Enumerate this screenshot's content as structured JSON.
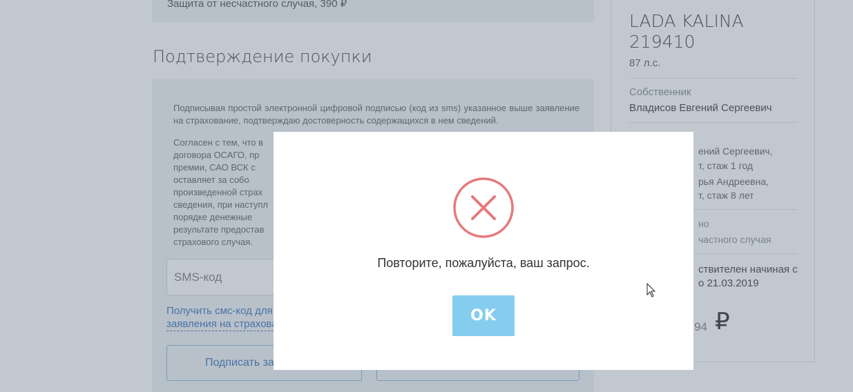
{
  "background": {
    "top_box_text": "Защита от несчастного случая, 390 ₽",
    "section_title": "Подтверждение покупки",
    "paragraph_1": "Подписывая простой электронной цифровой подписью (код из sms) указанное выше заявление на страхование, подтверждаю достоверность содержащихся в нем сведений.",
    "paragraph_2_lines": [
      "Согласен с тем, что в",
      "договора ОСАГО, пр",
      "премии, САО ВСК с",
      "оставляет за собо",
      "произведенной страх",
      "сведения, при наступл",
      "порядке денежные",
      "результате предостав",
      "страхового случая."
    ],
    "sms_placeholder": "SMS-код",
    "sms_link": "Получить смс-код для заявления на страхова",
    "sign_button": "Подписать за"
  },
  "sidebar": {
    "car_title": "LADA KALINA 219410",
    "car_hp": "87 л.с.",
    "owner_label": "Собственник",
    "owner_name": "Владисов Евгений Сергеевич",
    "driver_1a": "ений Сергеевич,",
    "driver_1b": "т, стаж 1 год",
    "driver_2a": "рья Андреевна,",
    "driver_2b": "т, стаж 8 лет",
    "extra_a": "но",
    "extra_b": "частного случая",
    "valid_a": "ствителен начиная с",
    "valid_b": "о 21.03.2019",
    "price_fragment": "94",
    "currency": "₽"
  },
  "modal": {
    "icon": "error-x-circle-icon",
    "message": "Повторите, пожалуйста, ваш запрос.",
    "ok_label": "OK",
    "icon_color": "#e8787a",
    "button_color": "#85cdef"
  }
}
